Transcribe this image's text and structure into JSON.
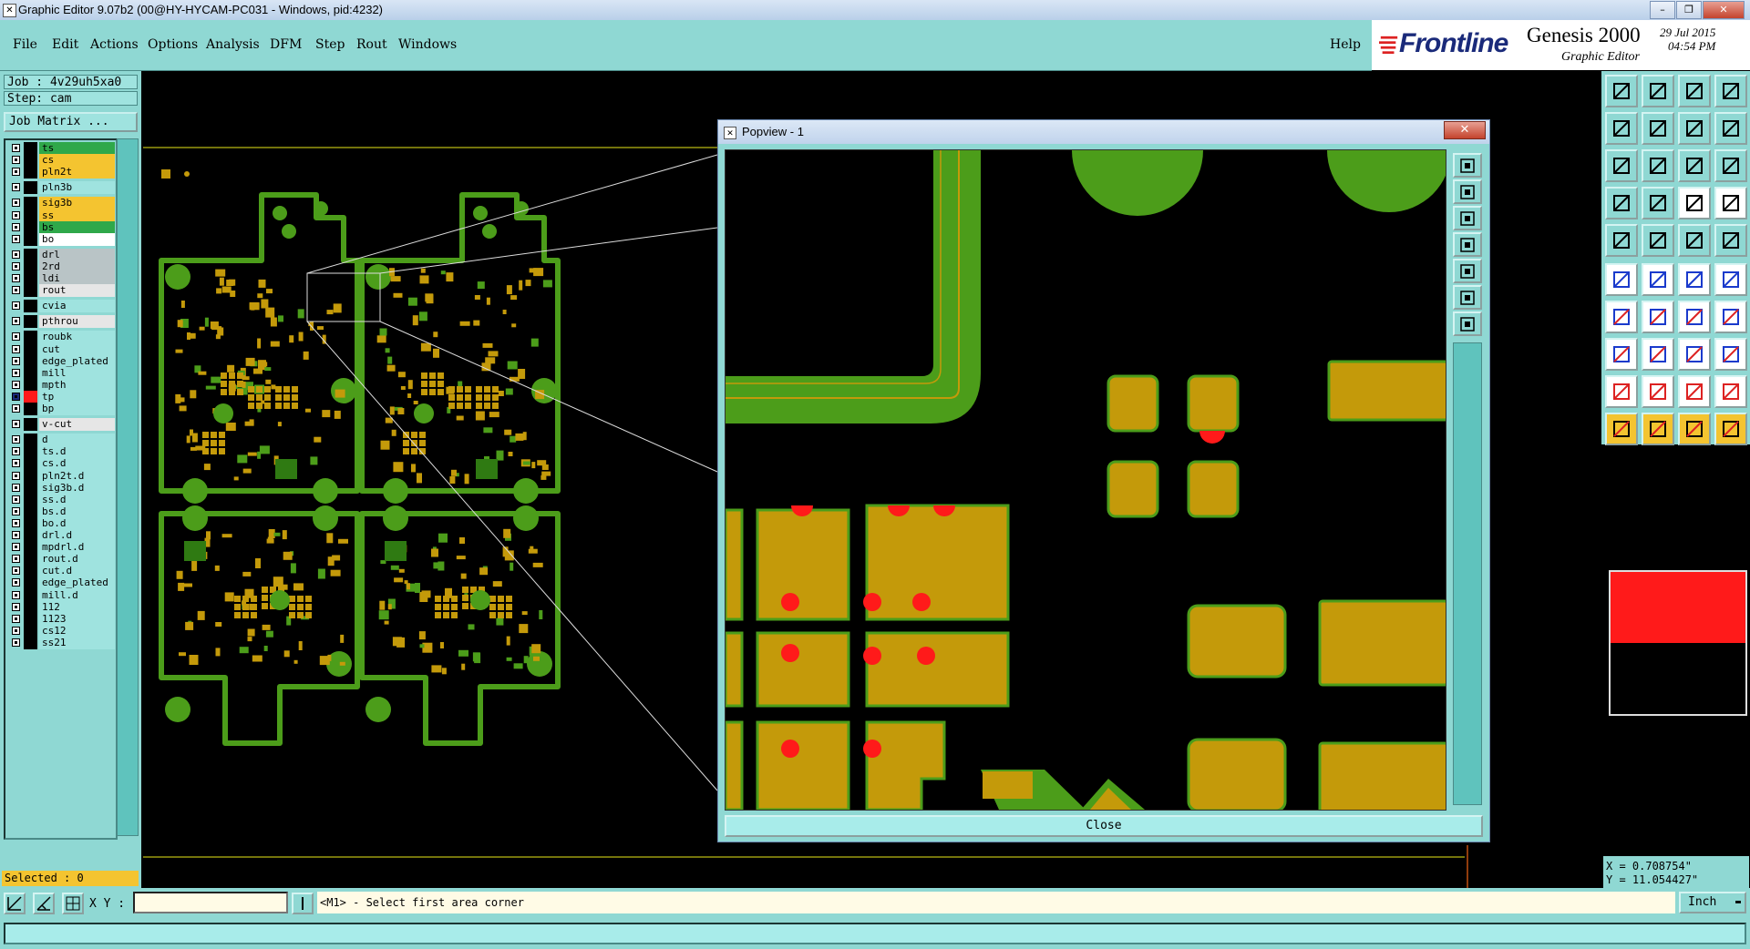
{
  "window": {
    "title": "Graphic Editor 9.07b2 (00@HY-HYCAM-PC031 - Windows, pid:4232)"
  },
  "menu": [
    "File",
    "Edit",
    "Actions",
    "Options",
    "Analysis",
    "DFM",
    "Step",
    "Rout",
    "Windows"
  ],
  "help_label": "Help",
  "brand": {
    "logo": "Frontline",
    "product": "Genesis 2000",
    "subtitle": "Graphic Editor",
    "date": "29 Jul 2015",
    "time": "04:54 PM"
  },
  "job": {
    "job_label": "Job : 4v29uh5xa0",
    "step_label": "Step: cam",
    "matrix_button": "Job Matrix ..."
  },
  "layers": [
    {
      "name": "ts",
      "color": "#2fa84a",
      "group": 0
    },
    {
      "name": "cs",
      "color": "#f4c430",
      "group": 0
    },
    {
      "name": "pln2t",
      "color": "#f4c430",
      "group": 0
    },
    {
      "name": "pln3b",
      "color": "#9fe3df",
      "group": 1
    },
    {
      "name": "sig3b",
      "color": "#f4c430",
      "group": 2
    },
    {
      "name": "ss",
      "color": "#f4c430",
      "group": 2
    },
    {
      "name": "bs",
      "color": "#2fa84a",
      "group": 2
    },
    {
      "name": "bo",
      "color": "#ffffff",
      "group": 2
    },
    {
      "name": "drl",
      "color": "#b9c4c6",
      "group": 3
    },
    {
      "name": "2rd",
      "color": "#b9c4c6",
      "group": 3
    },
    {
      "name": "ldi",
      "color": "#b9c4c6",
      "group": 3
    },
    {
      "name": "rout",
      "color": "#e6e6e6",
      "group": 3
    },
    {
      "name": "cvia",
      "color": "#9fe3df",
      "group": 4
    },
    {
      "name": "pthrou",
      "color": "#e6e6e6",
      "group": 5
    },
    {
      "name": "roubk",
      "color": "#9fe3df",
      "group": 6
    },
    {
      "name": "cut",
      "color": "#9fe3df",
      "group": 6
    },
    {
      "name": "edge_plated",
      "color": "#9fe3df",
      "group": 6
    },
    {
      "name": "mill",
      "color": "#9fe3df",
      "group": 6
    },
    {
      "name": "mpth",
      "color": "#9fe3df",
      "group": 6
    },
    {
      "name": "tp",
      "color": "#9fe3df",
      "group": 6,
      "active": true
    },
    {
      "name": "bp",
      "color": "#9fe3df",
      "group": 6
    },
    {
      "name": "v-cut",
      "color": "#e6e6e6",
      "group": 7
    },
    {
      "name": "d",
      "color": "#9fe3df",
      "group": 8
    },
    {
      "name": "ts.d",
      "color": "#9fe3df",
      "group": 8
    },
    {
      "name": "cs.d",
      "color": "#9fe3df",
      "group": 8
    },
    {
      "name": "pln2t.d",
      "color": "#9fe3df",
      "group": 8
    },
    {
      "name": "sig3b.d",
      "color": "#9fe3df",
      "group": 8
    },
    {
      "name": "ss.d",
      "color": "#9fe3df",
      "group": 8
    },
    {
      "name": "bs.d",
      "color": "#9fe3df",
      "group": 8
    },
    {
      "name": "bo.d",
      "color": "#9fe3df",
      "group": 8
    },
    {
      "name": "drl.d",
      "color": "#9fe3df",
      "group": 8
    },
    {
      "name": "mpdrl.d",
      "color": "#9fe3df",
      "group": 8
    },
    {
      "name": "rout.d",
      "color": "#9fe3df",
      "group": 8
    },
    {
      "name": "cut.d",
      "color": "#9fe3df",
      "group": 8
    },
    {
      "name": "edge_plated",
      "color": "#9fe3df",
      "group": 8
    },
    {
      "name": "mill.d",
      "color": "#9fe3df",
      "group": 8
    },
    {
      "name": "112",
      "color": "#9fe3df",
      "group": 8
    },
    {
      "name": "1123",
      "color": "#9fe3df",
      "group": 8
    },
    {
      "name": "cs12",
      "color": "#9fe3df",
      "group": 8
    },
    {
      "name": "ss21",
      "color": "#9fe3df",
      "group": 8
    }
  ],
  "selected_label": "Selected : 0",
  "popview": {
    "title": "Popview - 1",
    "close_label": "Close"
  },
  "coords": {
    "x": "X = 0.708754\"",
    "y": "Y = 11.054427\""
  },
  "bottom": {
    "xy_label": "X Y :",
    "xy_value": "",
    "prompt": "<M1> - Select first area corner",
    "unit": "Inch"
  },
  "colors": {
    "copper": "#c49a0a",
    "mask": "#4c9d1a",
    "panel": "#8fd8d3",
    "highlight": "#ff1a1a"
  }
}
